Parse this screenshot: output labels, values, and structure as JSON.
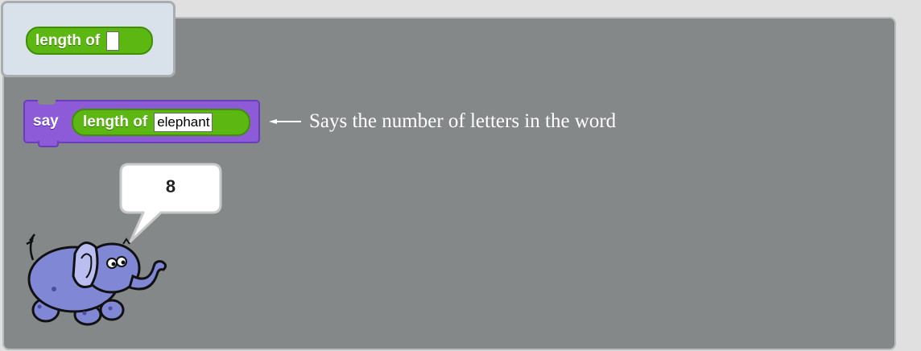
{
  "palette": {
    "reporter_label": "length of"
  },
  "script": {
    "say_label": "say",
    "reporter_label": "length of",
    "input_value": "elephant"
  },
  "annotation": {
    "text": "Says the number of letters in the word"
  },
  "speech_bubble": {
    "text": "8"
  },
  "colors": {
    "operator_green": "#5cb712",
    "looks_purple": "#8e5bd8",
    "stage_gray": "#858889",
    "palette_bg": "#d9e1ea"
  },
  "sprite": {
    "icon": "elephant-sprite-icon"
  }
}
